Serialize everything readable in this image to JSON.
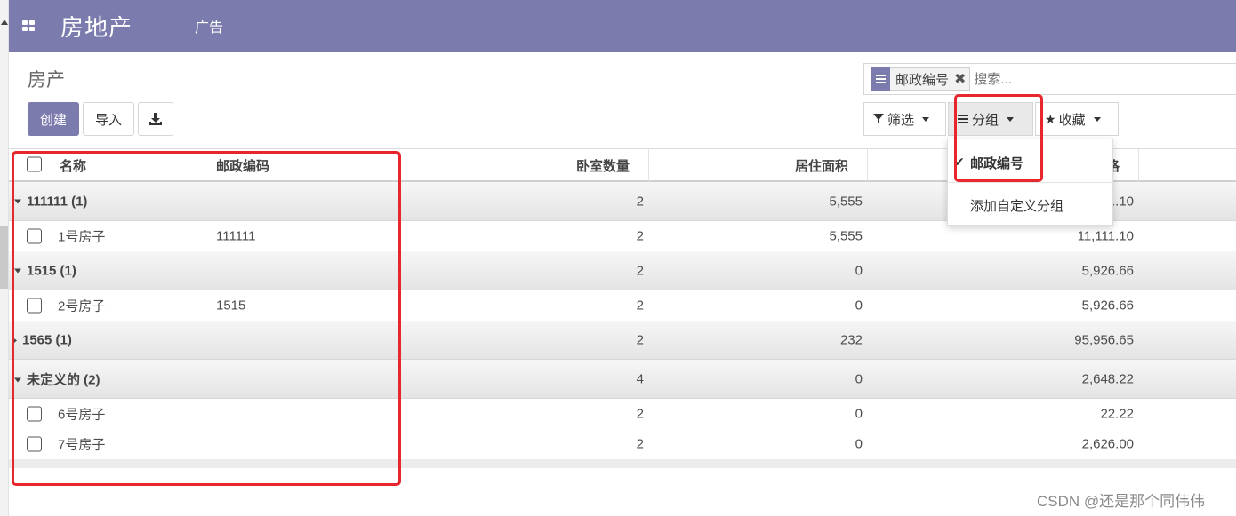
{
  "navbar": {
    "brand": "房地产",
    "menu_item": "广告"
  },
  "breadcrumb": "房产",
  "buttons": {
    "create": "创建",
    "import": "导入"
  },
  "search": {
    "facet_label": "邮政编号",
    "placeholder": "搜索..."
  },
  "filters": {
    "filter": "筛选",
    "group_by": "分组",
    "favorites": "收藏"
  },
  "groupby_menu": {
    "selected": "邮政编号",
    "custom": "添加自定义分组"
  },
  "table": {
    "columns": [
      "名称",
      "邮政编码",
      "卧室数量",
      "居住面积",
      "格"
    ],
    "groups": [
      {
        "label": "111111 (1)",
        "bedrooms": "2",
        "area": "5,555",
        "price": "...10",
        "expanded": true,
        "records": [
          {
            "name": "1号房子",
            "zip": "111111",
            "bedrooms": "2",
            "area": "5,555",
            "price": "11,111.10"
          }
        ]
      },
      {
        "label": "1515 (1)",
        "bedrooms": "2",
        "area": "0",
        "price": "5,926.66",
        "expanded": true,
        "records": [
          {
            "name": "2号房子",
            "zip": "1515",
            "bedrooms": "2",
            "area": "0",
            "price": "5,926.66"
          }
        ]
      },
      {
        "label": "1565 (1)",
        "bedrooms": "2",
        "area": "232",
        "price": "95,956.65",
        "expanded": false,
        "records": []
      },
      {
        "label": "未定义的 (2)",
        "bedrooms": "4",
        "area": "0",
        "price": "2,648.22",
        "expanded": true,
        "records": [
          {
            "name": "6号房子",
            "zip": "",
            "bedrooms": "2",
            "area": "0",
            "price": "22.22"
          },
          {
            "name": "7号房子",
            "zip": "",
            "bedrooms": "2",
            "area": "0",
            "price": "2,626.00"
          }
        ]
      }
    ]
  },
  "watermark": "CSDN @还是那个同伟伟",
  "colors": {
    "navbar": "#7c7bad",
    "highlight": "#e8262d"
  },
  "icons": [
    "apps-icon",
    "download-icon",
    "filter-icon",
    "bars-icon",
    "star-icon",
    "check-icon",
    "remove-icon",
    "caret-down-icon"
  ]
}
